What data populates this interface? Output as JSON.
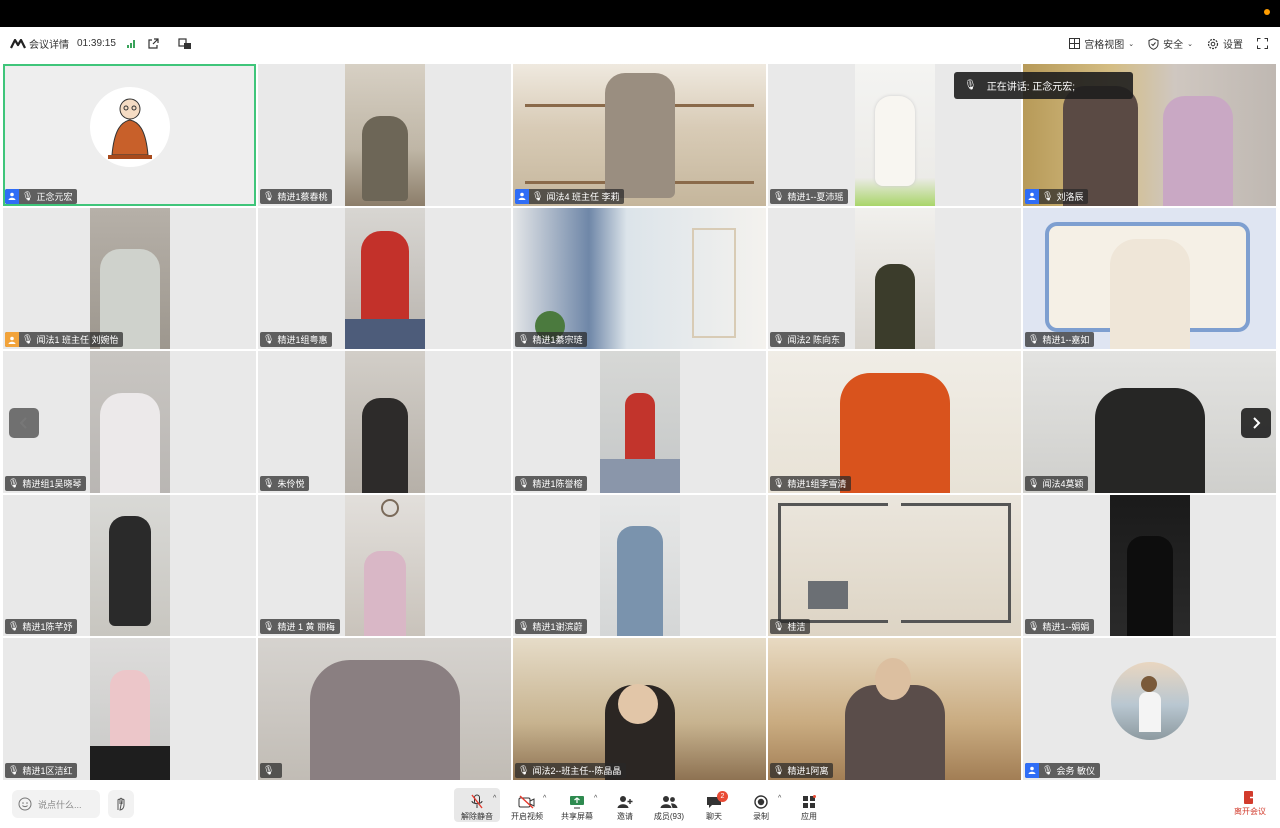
{
  "header": {
    "meeting_info_label": "会议详情",
    "duration": "01:39:15",
    "view_label": "宫格视图",
    "security_label": "安全",
    "settings_label": "设置"
  },
  "speaking": {
    "label": "正在讲话:",
    "name": "正念元宏;"
  },
  "participants": [
    {
      "name": "正念元宏"
    },
    {
      "name": "精进1蔡春桃"
    },
    {
      "name": "闻法4 班主任 李莉"
    },
    {
      "name": "精进1--夏沛瑶"
    },
    {
      "name": "刘洛辰"
    },
    {
      "name": "闻法1 班主任 刘婉怡"
    },
    {
      "name": "精进1组粤惠"
    },
    {
      "name": "精进1綦宗琏"
    },
    {
      "name": "闻法2 陈向东"
    },
    {
      "name": "精进1--嘉如"
    },
    {
      "name": "精进组1吴晓琴"
    },
    {
      "name": "朱伶悦"
    },
    {
      "name": "精进1陈誉榕"
    },
    {
      "name": "精进1组李雪清"
    },
    {
      "name": "闻法4莫颖"
    },
    {
      "name": "精进1陈芊妤"
    },
    {
      "name": "精进 1 黄 丽梅"
    },
    {
      "name": "精进1谢滨蔚"
    },
    {
      "name": "桂洁"
    },
    {
      "name": "精进1--娟娟"
    },
    {
      "name": "精进1区洁红"
    },
    {
      "name": ""
    },
    {
      "name": "闻法2--班主任--陈晶晶"
    },
    {
      "name": "精进1阿离"
    },
    {
      "name": "会务 敏仪"
    }
  ],
  "bottombar": {
    "chat_placeholder": "说点什么...",
    "unmute_label": "解除静音",
    "video_label": "开启视频",
    "share_label": "共享屏幕",
    "invite_label": "邀请",
    "members_label": "成员(93)",
    "chat_label": "聊天",
    "chat_badge": "2",
    "record_label": "录制",
    "apps_label": "应用",
    "leave_label": "离开会议"
  }
}
